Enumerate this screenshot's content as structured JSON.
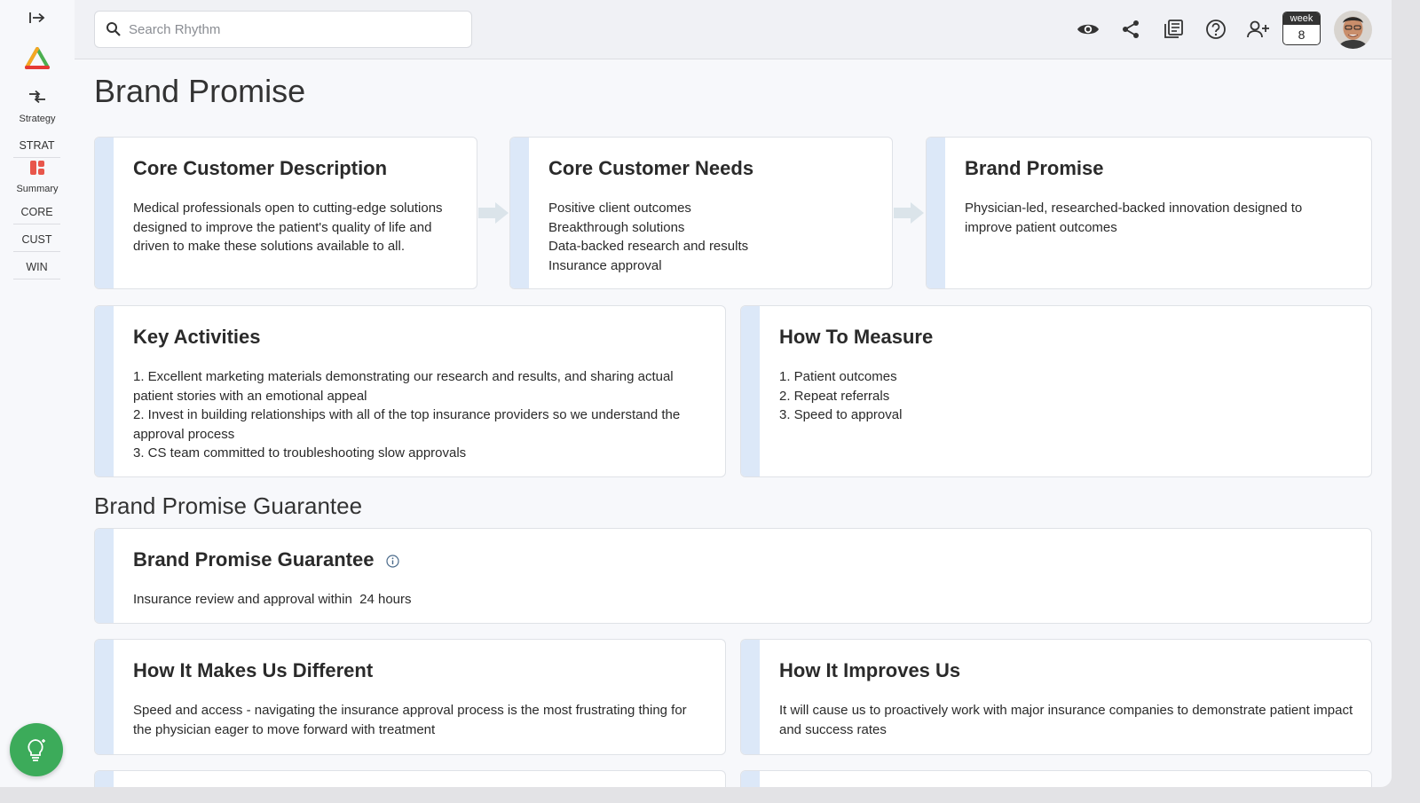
{
  "sidebar": {
    "nav": [
      {
        "label": "Strategy"
      },
      {
        "label": "Summary"
      }
    ],
    "abbr": [
      "STRAT",
      "CORE",
      "CUST",
      "WIN"
    ]
  },
  "topbar": {
    "search_placeholder": "Search Rhythm",
    "week_label": "week",
    "week_number": "8"
  },
  "page": {
    "title": "Brand Promise",
    "cards": {
      "core_customer_description": {
        "title": "Core Customer Description",
        "body": "Medical professionals open to cutting-edge solutions designed to improve the patient's quality of life and driven to make these solutions available to all."
      },
      "core_customer_needs": {
        "title": "Core Customer Needs",
        "lines": [
          "Positive client outcomes",
          "Breakthrough solutions",
          "Data-backed research and results",
          "Insurance approval"
        ]
      },
      "brand_promise": {
        "title": "Brand Promise",
        "body": "Physician-led, researched-backed innovation designed to improve patient outcomes"
      },
      "key_activities": {
        "title": "Key Activities",
        "lines": [
          "1. Excellent marketing materials demonstrating our research and results, and sharing actual patient stories with an emotional appeal",
          "2. Invest in building relationships with all of the top insurance providers so we understand the approval process",
          "3. CS team committed to troubleshooting slow approvals"
        ]
      },
      "how_to_measure": {
        "title": "How To Measure",
        "lines": [
          "1. Patient outcomes",
          "2. Repeat referrals",
          "3. Speed to approval"
        ]
      }
    },
    "guarantee_section": {
      "title": "Brand Promise Guarantee",
      "card": {
        "title": "Brand Promise Guarantee",
        "body": "Insurance review and approval within  24 hours"
      },
      "different": {
        "title": "How It Makes Us Different",
        "body": "Speed and access - navigating the insurance approval process is the most frustrating thing for the physician eager to move forward with treatment"
      },
      "improves": {
        "title": "How It Improves Us",
        "body": "It will cause us to proactively work with major insurance companies to demonstrate patient impact and success rates"
      }
    }
  },
  "colors": {
    "accent_stripe": "#dce8f8",
    "fab_green": "#3cab5a",
    "summary_icon": "#e8564b"
  }
}
